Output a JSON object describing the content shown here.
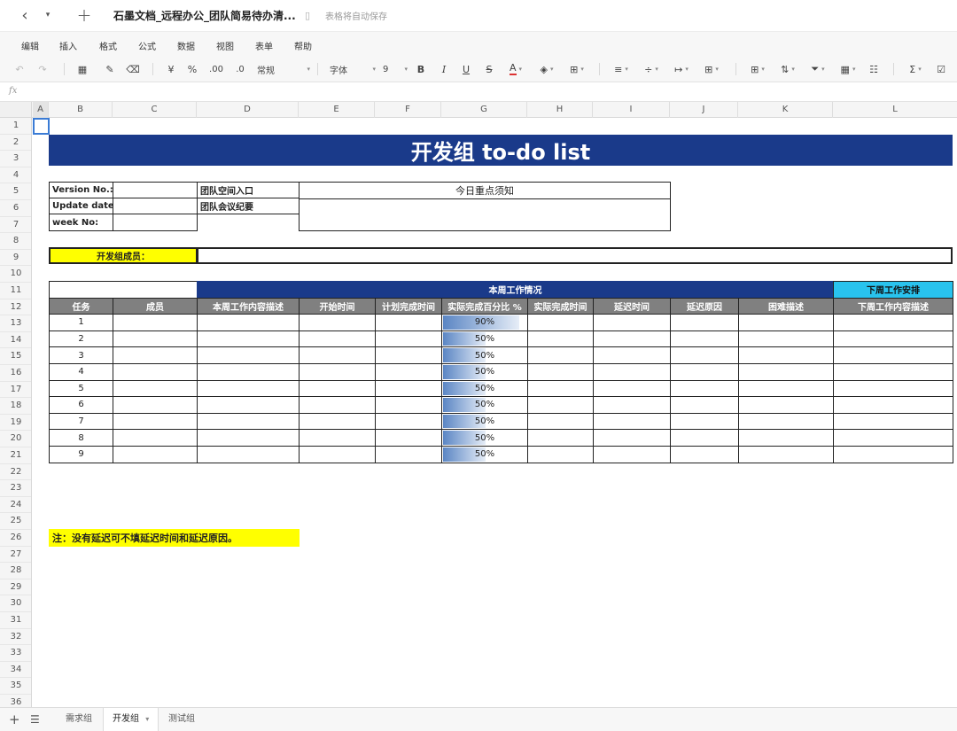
{
  "titlebar": {
    "doc_title": "石墨文档_远程办公_团队简易待办清...",
    "autosave": "表格将自动保存",
    "back_glyph": "‹",
    "dropdown_glyph": "▾",
    "new_glyph": "+",
    "bookmark_glyph": "▯"
  },
  "menu": [
    "编辑",
    "插入",
    "格式",
    "公式",
    "数据",
    "视图",
    "表单",
    "帮助"
  ],
  "toolbar": {
    "undo": "↶",
    "redo": "↷",
    "paint": "▦",
    "brush": "✎",
    "eraser": "⌫",
    "currency": "¥",
    "percent": "%",
    "dec_more": ".00",
    "dec_less": ".0",
    "format_label": "常规",
    "font_label": "字体",
    "font_size": "9",
    "bold": "B",
    "italic": "I",
    "underline": "U",
    "strike": "S",
    "text_color": "A",
    "fill": "◈",
    "border": "⊞",
    "align": "≡",
    "valign": "÷",
    "wrap": "↦",
    "merge": "⊞",
    "table": "⊞",
    "sort": "⇅",
    "filter": "⏷",
    "freeze": "▦",
    "cond": "☷",
    "sum": "Σ",
    "check": "☑",
    "dd": "▾"
  },
  "formula": {
    "fx": "fx"
  },
  "columns": [
    "A",
    "B",
    "C",
    "D",
    "E",
    "F",
    "G",
    "H",
    "I",
    "J",
    "K",
    "L"
  ],
  "rows": [
    "1",
    "2",
    "3",
    "4",
    "5",
    "6",
    "7",
    "8",
    "9",
    "10",
    "11",
    "12",
    "13",
    "14",
    "15",
    "16",
    "17",
    "18",
    "19",
    "20",
    "21",
    "22",
    "23",
    "24",
    "25",
    "26",
    "27",
    "28",
    "29",
    "30",
    "31",
    "32",
    "33",
    "34",
    "35",
    "36"
  ],
  "sheet": {
    "banner": "开发组 to-do list",
    "info": {
      "version_label": "Version No.:",
      "update_label": "Update date:",
      "week_label": "week No:",
      "space_link": "团队空间入口",
      "meeting_link": "团队会议纪要",
      "notice": "今日重点须知"
    },
    "members_label": "开发组成员：",
    "this_week": "本周工作情况",
    "next_week": "下周工作安排",
    "headers": [
      "任务",
      "成员",
      "本周工作内容描述",
      "开始时间",
      "计划完成时间",
      "实际完成百分比 %",
      "实际完成时间",
      "延迟时间",
      "延迟原因",
      "困难描述",
      "下周工作内容描述"
    ],
    "tasks": [
      {
        "id": "1",
        "pct": "90%",
        "value": 0.9
      },
      {
        "id": "2",
        "pct": "50%",
        "value": 0.5
      },
      {
        "id": "3",
        "pct": "50%",
        "value": 0.5
      },
      {
        "id": "4",
        "pct": "50%",
        "value": 0.5
      },
      {
        "id": "5",
        "pct": "50%",
        "value": 0.5
      },
      {
        "id": "6",
        "pct": "50%",
        "value": 0.5
      },
      {
        "id": "7",
        "pct": "50%",
        "value": 0.5
      },
      {
        "id": "8",
        "pct": "50%",
        "value": 0.5
      },
      {
        "id": "9",
        "pct": "50%",
        "value": 0.5
      }
    ],
    "note": "注：没有延迟可不填延迟时间和延迟原因。"
  },
  "sheet_tabs": {
    "add": "+",
    "list": "☰",
    "tabs": [
      "需求组",
      "开发组",
      "测试组"
    ],
    "active_index": 1,
    "active_dd": "▾"
  },
  "colors": {
    "banner": "#1a3a8a",
    "cyan": "#29c3ee",
    "yellow": "#ffff00",
    "header_gray": "#808080"
  }
}
